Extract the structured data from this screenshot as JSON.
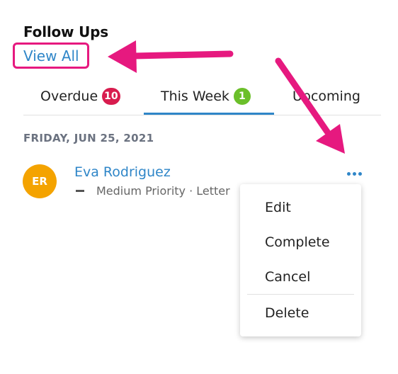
{
  "colors": {
    "accent": "#2f86c8",
    "annotation": "#e6197f",
    "overdue_badge": "#d81c4e",
    "week_badge": "#6bbf2a",
    "avatar": "#f4a300"
  },
  "header": {
    "title": "Follow Ups",
    "view_all": "View All"
  },
  "tabs": [
    {
      "label": "Overdue",
      "badge": "10"
    },
    {
      "label": "This Week",
      "badge": "1",
      "active": true
    },
    {
      "label": "Upcoming"
    }
  ],
  "list": {
    "date_header": "FRIDAY, JUN 25, 2021",
    "item": {
      "avatar_initials": "ER",
      "name": "Eva Rodriguez",
      "meta": "Medium Priority · Letter",
      "more_icon": "more-horizontal-icon"
    }
  },
  "menu": {
    "items": [
      "Edit",
      "Complete",
      "Cancel",
      "Delete"
    ]
  }
}
